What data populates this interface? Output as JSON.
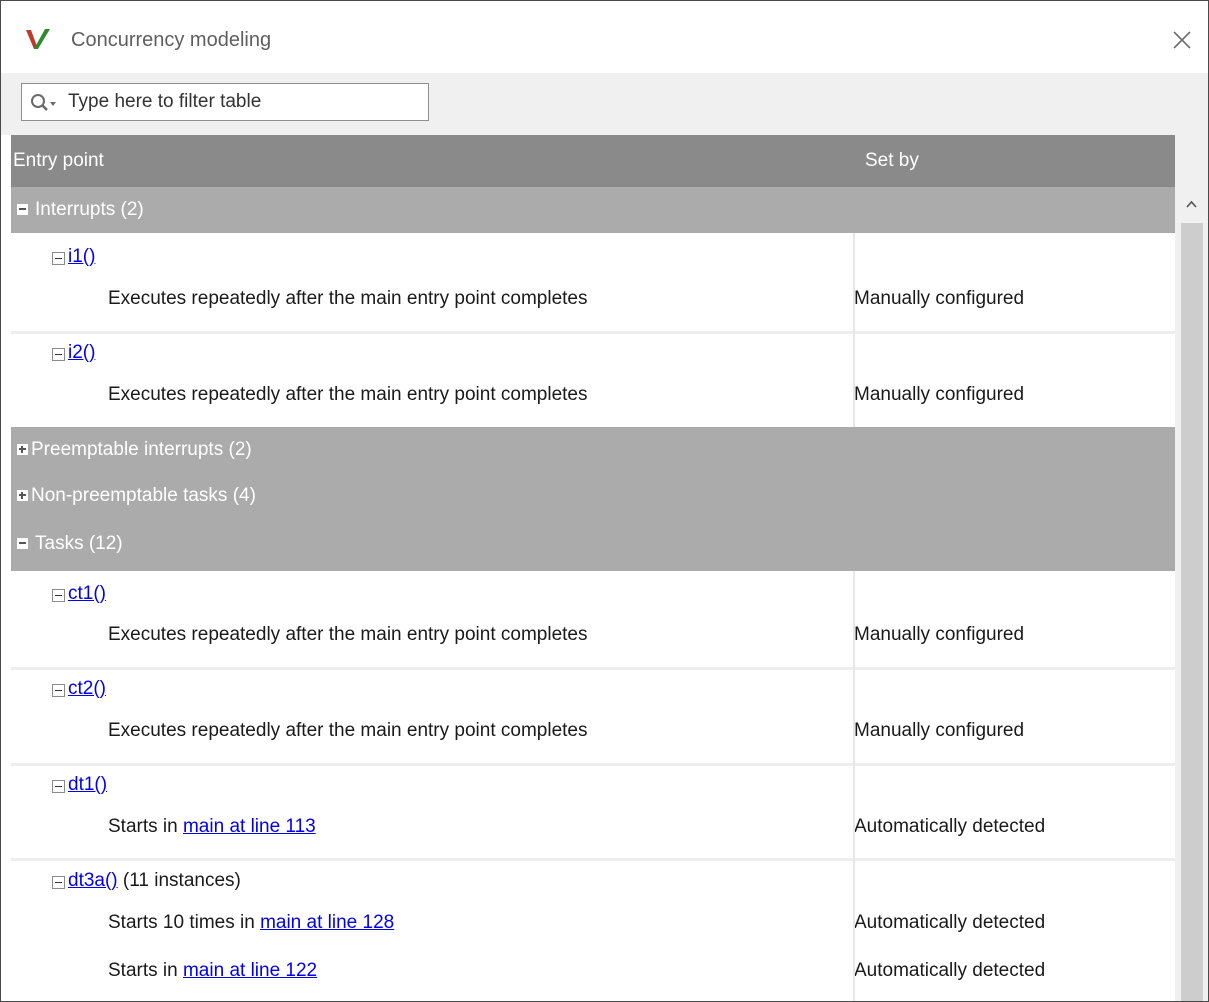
{
  "window": {
    "title": "Concurrency modeling"
  },
  "filter": {
    "placeholder": "Type here to filter table"
  },
  "table": {
    "columns": {
      "entry": "Entry point",
      "set_by": "Set by"
    },
    "groups": {
      "interrupts": {
        "label": "Interrupts (2)"
      },
      "preemptable": {
        "label": "Preemptable interrupts (2)"
      },
      "nonpreemptable": {
        "label": "Non-preemptable tasks (4)"
      },
      "tasks": {
        "label": "Tasks (12)"
      }
    },
    "entries": {
      "i1": {
        "name": "i1()",
        "detail": "Executes repeatedly after the main entry point completes",
        "set_by": "Manually configured"
      },
      "i2": {
        "name": "i2()",
        "detail": "Executes repeatedly after the main entry point completes",
        "set_by": "Manually configured"
      },
      "ct1": {
        "name": "ct1()",
        "detail": "Executes repeatedly after the main entry point completes",
        "set_by": "Manually configured"
      },
      "ct2": {
        "name": "ct2()",
        "detail": "Executes repeatedly after the main entry point completes",
        "set_by": "Manually configured"
      },
      "dt1": {
        "name": "dt1()",
        "detail_prefix": "Starts in ",
        "detail_link": "main at line 113",
        "set_by": "Automatically detected"
      },
      "dt3a": {
        "name": "dt3a()",
        "suffix": " (11 instances)",
        "d1_prefix": "Starts 10 times in ",
        "d1_link": "main at line 128",
        "d1_set_by": "Automatically detected",
        "d2_prefix": "Starts in ",
        "d2_link": "main at line 122",
        "d2_set_by": "Automatically detected"
      }
    }
  },
  "colors": {
    "header_bg": "#8a8a8a",
    "group_bg": "#ababab",
    "link": "#0000ee",
    "logo_green": "#2e8b2e",
    "logo_red": "#c0392b"
  },
  "icons": {
    "app": "polyspace-check-icon",
    "close": "close-icon",
    "filter": "search-dropdown-icon",
    "scroll_up": "chevron-up-icon"
  }
}
